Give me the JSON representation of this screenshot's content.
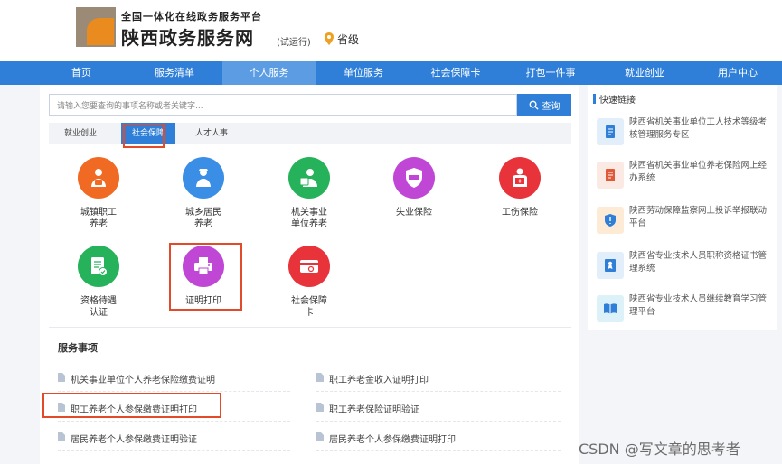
{
  "header": {
    "site_subtitle": "全国一体化在线政务服务平台",
    "site_title": "陕西政务服务网",
    "trial_label": "(试运行)",
    "location_label": "省级"
  },
  "nav": {
    "items": [
      "首页",
      "服务清单",
      "个人服务",
      "单位服务",
      "社会保障卡",
      "打包一件事",
      "就业创业",
      "用户中心"
    ],
    "active_index": 2
  },
  "search": {
    "placeholder": "请输入您要查询的事项名称或者关键字...",
    "button_label": "查询"
  },
  "tabs": {
    "items": [
      "就业创业",
      "社会保障",
      "人才人事"
    ],
    "active_index": 1
  },
  "services": [
    {
      "label": "城镇职工\n养老",
      "icon": "urban-worker-pension-icon",
      "color": "#f06a24"
    },
    {
      "label": "城乡居民\n养老",
      "icon": "rural-resident-pension-icon",
      "color": "#3a8ee6"
    },
    {
      "label": "机关事业\n单位养老",
      "icon": "institution-pension-icon",
      "color": "#25b25a"
    },
    {
      "label": "失业保险",
      "icon": "unemployment-insurance-icon",
      "color": "#c047d6"
    },
    {
      "label": "工伤保险",
      "icon": "work-injury-insurance-icon",
      "color": "#e8333a"
    },
    {
      "label": "资格待遇\n认证",
      "icon": "qualification-certification-icon",
      "color": "#25b25a"
    },
    {
      "label": "证明打印",
      "icon": "printer-icon",
      "color": "#c047d6"
    },
    {
      "label": "社会保障\n卡",
      "icon": "social-security-card-icon",
      "color": "#e8333a"
    }
  ],
  "service_items_title": "服务事项",
  "service_items": [
    "机关事业单位个人养老保险缴费证明",
    "职工养老金收入证明打印",
    "职工养老个人参保缴费证明打印",
    "职工养老保险证明验证",
    "居民养老个人参保缴费证明验证",
    "居民养老个人参保缴费证明打印"
  ],
  "quick_links": {
    "title": "快速链接",
    "items": [
      {
        "label": "陕西省机关事业单位工人技术等级考核管理服务专区",
        "icon": "document-icon",
        "color": "#2f7fd8",
        "bg": "#e3eefb"
      },
      {
        "label": "陕西省机关事业单位养老保险网上经办系统",
        "icon": "document-icon",
        "color": "#e05a3a",
        "bg": "#fbe9e4"
      },
      {
        "label": "陕西劳动保障监察网上投诉举报联动平台",
        "icon": "shield-icon",
        "color": "#2f7fd8",
        "bg": "#fdebd6"
      },
      {
        "label": "陕西省专业技术人员职称资格证书管理系统",
        "icon": "certificate-icon",
        "color": "#2f7fd8",
        "bg": "#e3eefb"
      },
      {
        "label": "陕西省专业技术人员继续教育学习管理平台",
        "icon": "book-icon",
        "color": "#2f7fd8",
        "bg": "#ddf2f8"
      }
    ]
  },
  "watermark": "CSDN @写文章的思考者",
  "colors": {
    "primary": "#2f7fd8",
    "highlight_box": "#e24a2a"
  }
}
